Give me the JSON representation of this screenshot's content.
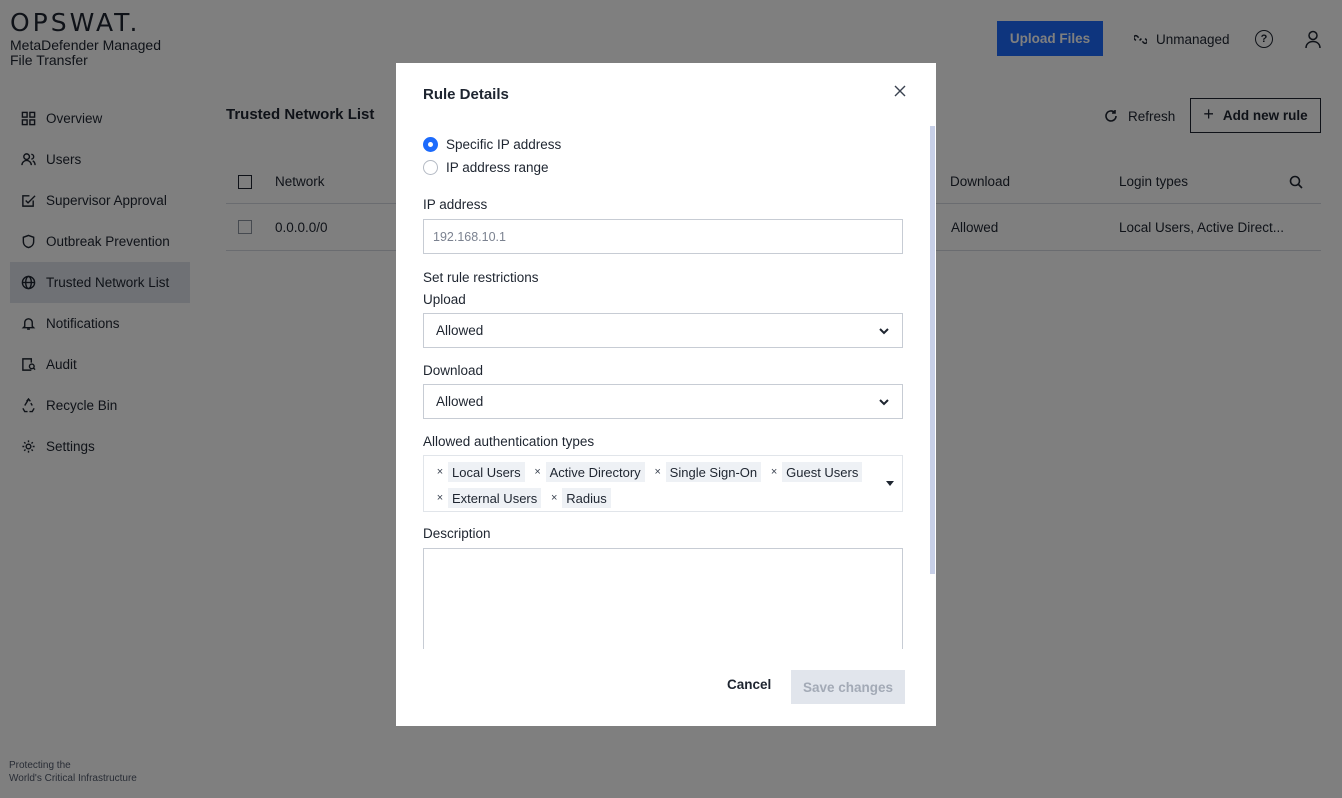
{
  "brand": {
    "logo": "OPSWAT.",
    "product": "MetaDefender Managed File Transfer"
  },
  "footer": {
    "line1": "Protecting the",
    "line2": "World's Critical Infrastructure"
  },
  "topbar": {
    "upload_label": "Upload Files",
    "unmanaged_label": "Unmanaged",
    "help_glyph": "?"
  },
  "sidebar": {
    "items": [
      {
        "label": "Overview",
        "icon": "grid-icon"
      },
      {
        "label": "Users",
        "icon": "users-icon"
      },
      {
        "label": "Supervisor Approval",
        "icon": "approval-icon"
      },
      {
        "label": "Outbreak Prevention",
        "icon": "shield-icon"
      },
      {
        "label": "Trusted Network List",
        "icon": "globe-icon",
        "active": true
      },
      {
        "label": "Notifications",
        "icon": "bell-icon"
      },
      {
        "label": "Audit",
        "icon": "audit-icon"
      },
      {
        "label": "Recycle Bin",
        "icon": "recycle-icon"
      },
      {
        "label": "Settings",
        "icon": "gear-icon"
      }
    ]
  },
  "page": {
    "title": "Trusted Network List",
    "refresh_label": "Refresh",
    "add_rule_label": "Add new rule",
    "table": {
      "headers": {
        "network": "Network",
        "download": "Download",
        "login_types": "Login types"
      },
      "rows": [
        {
          "network": "0.0.0.0/0",
          "download": "Allowed",
          "login_types": "Local Users, Active Direct..."
        }
      ]
    }
  },
  "modal": {
    "title": "Rule Details",
    "radio_specific": "Specific IP address",
    "radio_range": "IP address range",
    "ip_label": "IP address",
    "ip_placeholder": "192.168.10.1",
    "restrictions_label": "Set rule restrictions",
    "upload_label": "Upload",
    "upload_value": "Allowed",
    "download_label": "Download",
    "download_value": "Allowed",
    "auth_label": "Allowed authentication types",
    "auth_tags": [
      "Local Users",
      "Active Directory",
      "Single Sign-On",
      "Guest Users",
      "External Users",
      "Radius"
    ],
    "description_label": "Description",
    "cancel_label": "Cancel",
    "save_label": "Save changes"
  },
  "colors": {
    "primary": "#1d6bfc",
    "overlay": "rgba(0,0,0,0.5)",
    "disabled_bg": "#e1e5ec",
    "disabled_text": "#a3aab6"
  }
}
